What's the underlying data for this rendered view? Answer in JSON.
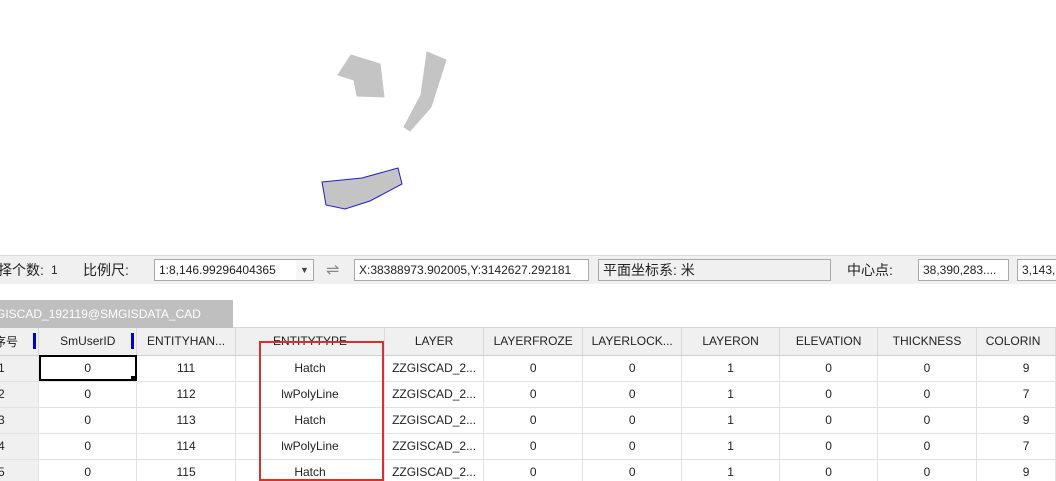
{
  "map": {
    "fill_color": "#c4c4c4",
    "selected_outline_color": "#1f1fcf"
  },
  "statusbar": {
    "selected_count_label": "择个数:",
    "selected_count_value": "1",
    "scale_label": "比例尺:",
    "scale_value": "1:8,146.99296404365",
    "swap_icon": "⇌",
    "coordinates": "X:38388973.902005,Y:3142627.292181",
    "coord_system": "平面坐标系: 米",
    "center_label": "中心点:",
    "center_x": "38,390,283....",
    "center_y": "3,143,"
  },
  "tab": {
    "title": "GISCAD_192119@SMGISDATA_CAD"
  },
  "table": {
    "columns": [
      "序号",
      "SmUserID",
      "ENTITYHAN...",
      "ENTITYTYPE",
      "LAYER",
      "LAYERFROZE",
      "LAYERLOCK...",
      "LAYERON",
      "ELEVATION",
      "THICKNESS",
      "COLORIN"
    ],
    "rows": [
      [
        "1",
        "0",
        "111",
        "Hatch",
        "ZZGISCAD_2...",
        "0",
        "0",
        "1",
        "0",
        "0",
        "9"
      ],
      [
        "2",
        "0",
        "112",
        "lwPolyLine",
        "ZZGISCAD_2...",
        "0",
        "0",
        "1",
        "0",
        "0",
        "7"
      ],
      [
        "3",
        "0",
        "113",
        "Hatch",
        "ZZGISCAD_2...",
        "0",
        "0",
        "1",
        "0",
        "0",
        "9"
      ],
      [
        "4",
        "0",
        "114",
        "lwPolyLine",
        "ZZGISCAD_2...",
        "0",
        "0",
        "1",
        "0",
        "0",
        "7"
      ],
      [
        "5",
        "0",
        "115",
        "Hatch",
        "ZZGISCAD_2...",
        "0",
        "0",
        "1",
        "0",
        "0",
        "9"
      ]
    ],
    "highlight_color": "#d9302c",
    "header_marker_color": "#0000dd"
  }
}
